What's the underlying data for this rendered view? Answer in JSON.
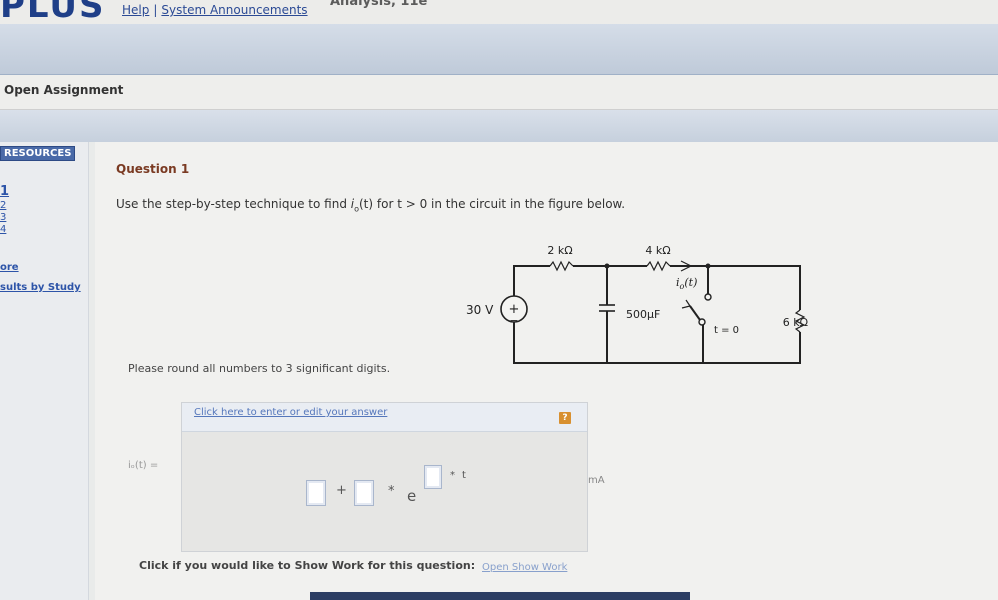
{
  "header": {
    "brand": "PLUS",
    "book_title_fragment": "Analysis, 11e",
    "links": [
      "Help",
      "System Announcements"
    ],
    "separator": "|"
  },
  "assignment_bar": {
    "title": "Open Assignment"
  },
  "sidebar": {
    "heading": "RESOURCES",
    "question_numbers": [
      "1",
      "2",
      "3",
      "4"
    ],
    "links": [
      "ore",
      "sults by Study"
    ]
  },
  "question": {
    "title": "Question 1",
    "prompt_before": "Use the step-by-step technique to find ",
    "prompt_var": "i",
    "prompt_sub": "o",
    "prompt_after": "(t) for t > 0 in the circuit in the figure below.",
    "round_note": "Please round all numbers to 3 significant digits."
  },
  "circuit": {
    "r1": "2 kΩ",
    "r2": "4 kΩ",
    "source": "30 V",
    "capacitor": "500μF",
    "switch": "t = 0",
    "r3": "6 kΩ",
    "current_label": "i",
    "current_sub": "o",
    "current_suffix": "(t)"
  },
  "answer": {
    "edit_link": "Click here to enter or edit your answer",
    "help_icon": "?",
    "lhs": "iₒ(t) =",
    "plus": "+",
    "times": "*",
    "base": "e",
    "exp_times": "*",
    "exp_var": "t",
    "unit": "mA"
  },
  "show_work": {
    "prompt": "Click if you would like to Show Work for this question:",
    "link": "Open Show Work"
  },
  "colors": {
    "brand": "#1f3f88",
    "link": "#2b4a95",
    "question_title": "#7a3a22",
    "help_icon": "#d89030"
  }
}
